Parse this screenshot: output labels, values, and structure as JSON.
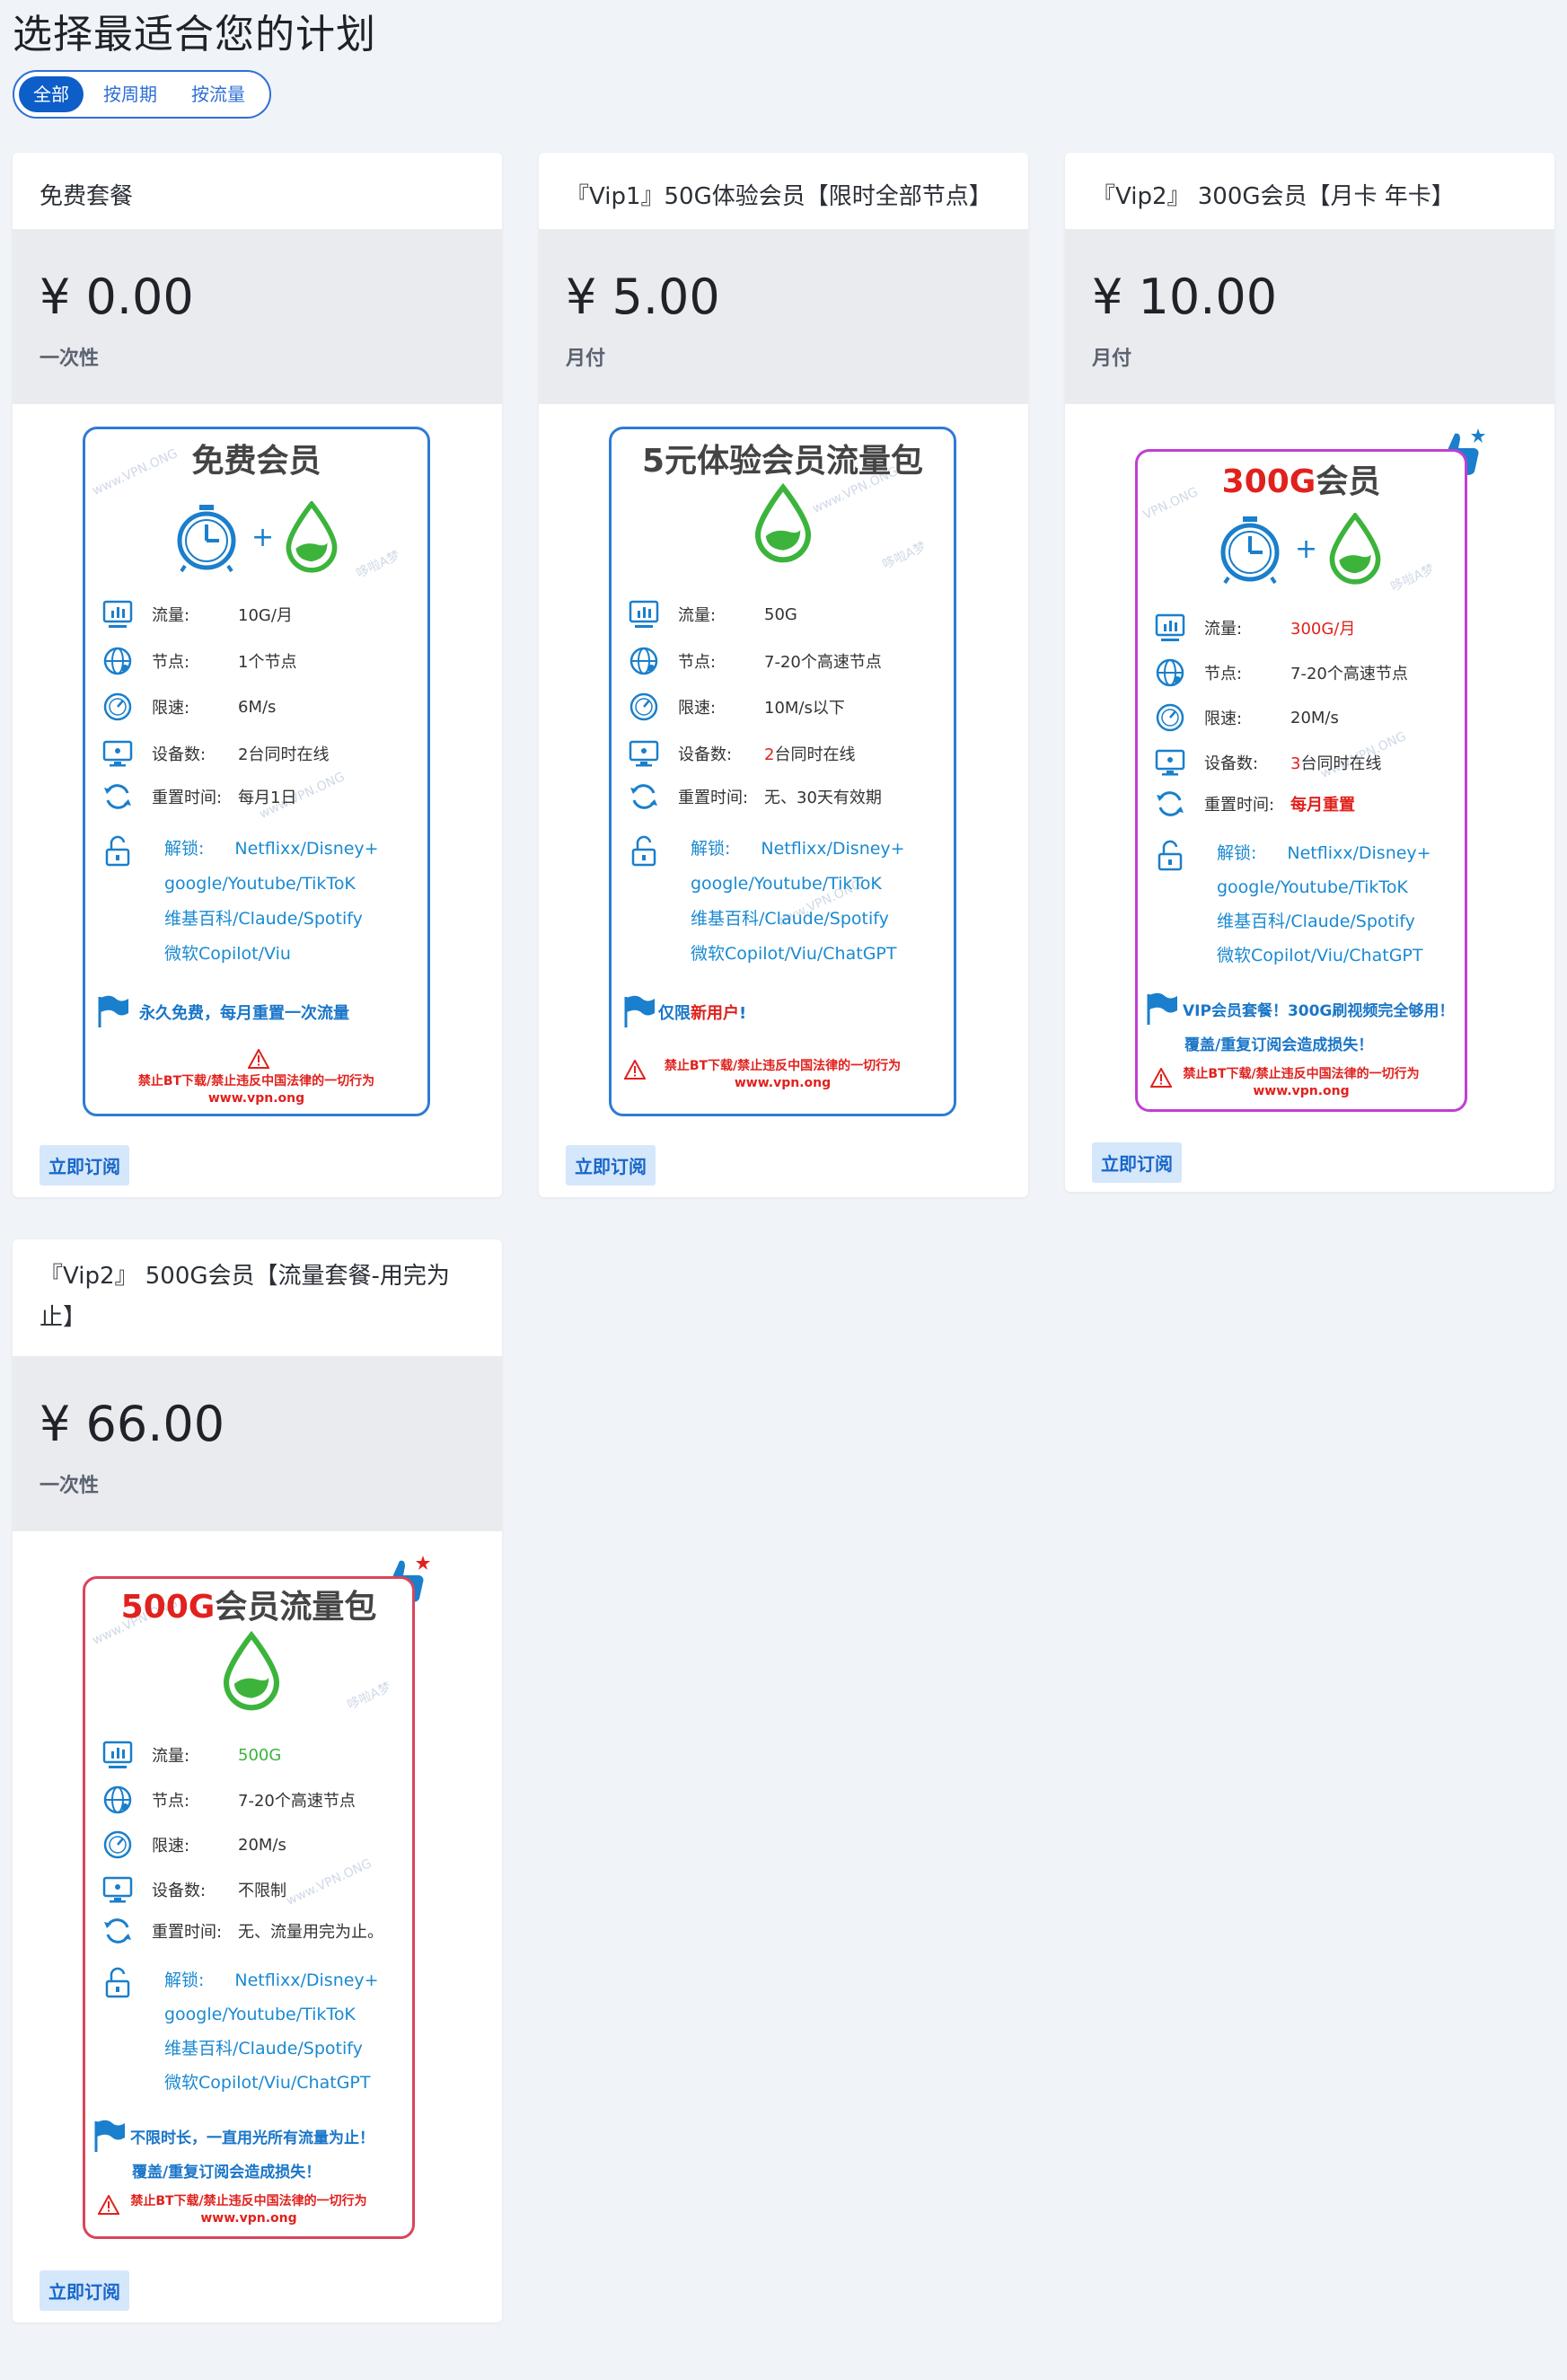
{
  "page": {
    "title": "选择最适合您的计划"
  },
  "tabs": [
    {
      "label": "全部",
      "active": true
    },
    {
      "label": "按周期",
      "active": false
    },
    {
      "label": "按流量",
      "active": false
    }
  ],
  "subscribe_label": "立即订阅",
  "plans": [
    {
      "name": "免费套餐",
      "price": "¥ 0.00",
      "period": "一次性",
      "poster": {
        "title": "免费会员",
        "rows": [
          {
            "label": "流量:",
            "value": "10G/月"
          },
          {
            "label": "节点:",
            "value": "1个节点"
          },
          {
            "label": "限速:",
            "value": "6M/s"
          },
          {
            "label": "设备数:",
            "value": "2台同时在线"
          },
          {
            "label": "重置时间:",
            "value": "每月1日"
          }
        ],
        "unlock_label": "解锁:",
        "unlock_lines": [
          "Netflixx/Disney+",
          "google/Youtube/TikToK",
          "维基百科/Claude/Spotify",
          "微软Copilot/Viu"
        ],
        "note": "永久免费，每月重置一次流量",
        "warn": [
          "禁止BT下载/禁止违反中国法律的一切行为",
          "www.vpn.ong"
        ]
      }
    },
    {
      "name": "『Vip1』50G体验会员【限时全部节点】",
      "price": "¥ 5.00",
      "period": "月付",
      "poster": {
        "title": "5元体验会员流量包",
        "rows": [
          {
            "label": "流量:",
            "value": "50G"
          },
          {
            "label": "节点:",
            "value": "7-20个高速节点"
          },
          {
            "label": "限速:",
            "value": "10M/s以下"
          },
          {
            "label": "设备数:",
            "value_red": "2",
            "value": "台同时在线"
          },
          {
            "label": "重置时间:",
            "value": "无、30天有效期"
          }
        ],
        "unlock_label": "解锁:",
        "unlock_lines": [
          "Netflixx/Disney+",
          "google/Youtube/TikToK",
          "维基百科/Claude/Spotify",
          "微软Copilot/Viu/ChatGPT"
        ],
        "note_prefix": "仅限",
        "note_red": "新用户",
        "note_suffix": "!",
        "warn": [
          "禁止BT下载/禁止违反中国法律的一切行为",
          "www.vpn.ong"
        ]
      }
    },
    {
      "name": "『Vip2』 300G会员【月卡 年卡】",
      "price": "¥ 10.00",
      "period": "月付",
      "poster": {
        "title_red": "300G",
        "title": "会员",
        "rows": [
          {
            "label": "流量:",
            "value_red": "300G/月"
          },
          {
            "label": "节点:",
            "value": "7-20个高速节点"
          },
          {
            "label": "限速:",
            "value": "20M/s"
          },
          {
            "label": "设备数:",
            "value_red": "3",
            "value": "台同时在线"
          },
          {
            "label": "重置时间:",
            "value_red": "每月重置"
          }
        ],
        "unlock_label": "解锁:",
        "unlock_lines": [
          "Netflixx/Disney+",
          "google/Youtube/TikToK",
          "维基百科/Claude/Spotify",
          "微软Copilot/Viu/ChatGPT"
        ],
        "note": "VIP会员套餐！300G刷视频完全够用！",
        "note2": "覆盖/重复订阅会造成损失！",
        "warn": [
          "禁止BT下载/禁止违反中国法律的一切行为",
          "www.vpn.ong"
        ]
      }
    },
    {
      "name": "『Vip2』 500G会员【流量套餐-用完为止】",
      "price": "¥ 66.00",
      "period": "一次性",
      "poster": {
        "title_red": "500G",
        "title": "会员流量包",
        "rows": [
          {
            "label": "流量:",
            "value_green": "500G"
          },
          {
            "label": "节点:",
            "value": "7-20个高速节点"
          },
          {
            "label": "限速:",
            "value": "20M/s"
          },
          {
            "label": "设备数:",
            "value": "不限制"
          },
          {
            "label": "重置时间:",
            "value": "无、流量用完为止。"
          }
        ],
        "unlock_label": "解锁:",
        "unlock_lines": [
          "Netflixx/Disney+",
          "google/Youtube/TikToK",
          "维基百科/Claude/Spotify",
          "微软Copilot/Viu/ChatGPT"
        ],
        "note": "不限时长，一直用光所有流量为止！",
        "note2": "覆盖/重复订阅会造成损失！",
        "warn": [
          "禁止BT下载/禁止违反中国法律的一切行为",
          "www.vpn.ong"
        ]
      }
    }
  ],
  "watermarks": [
    "www.VPN.ONG",
    "哆啦A梦",
    "VPN.ONG"
  ],
  "colors": {
    "accent": "#0d5ec9",
    "blue_border": "#2e7bd6",
    "purple_border": "#c13fd1",
    "red_border": "#d9455b",
    "red": "#e1211d",
    "green": "#3cb43c"
  }
}
